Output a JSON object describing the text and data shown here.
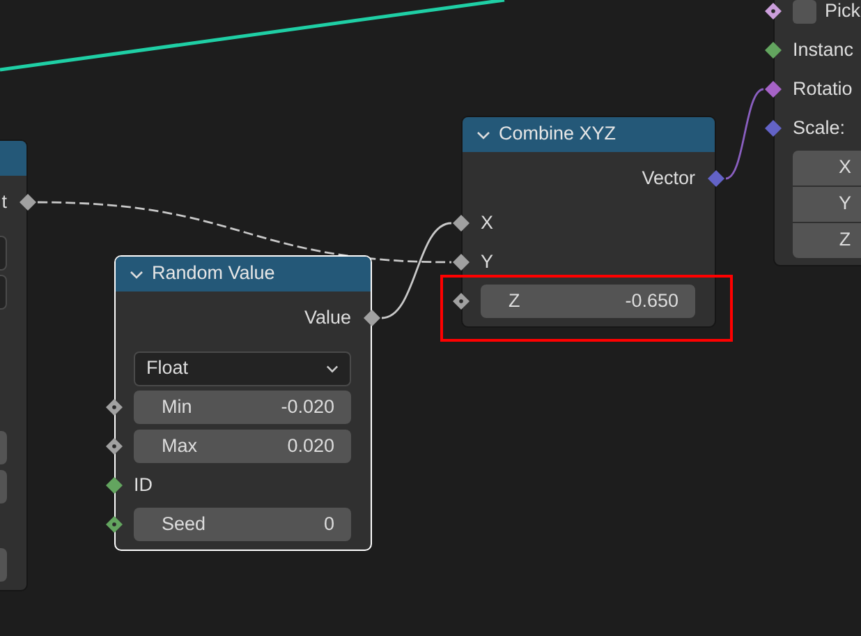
{
  "nodes": [
    {
      "kind": "partial_left",
      "selected": false,
      "rows": [
        {
          "kind": "output",
          "label": "t",
          "socket": {
            "color": "#a1a1a1",
            "dotted": false
          }
        },
        {
          "kind": "dropdown"
        },
        {
          "kind": "dropdown"
        },
        {
          "kind": "spacer"
        },
        {
          "kind": "spacer"
        },
        {
          "kind": "spacer"
        },
        {
          "kind": "field"
        },
        {
          "kind": "field"
        },
        {
          "kind": "spacer"
        },
        {
          "kind": "field"
        }
      ]
    },
    {
      "kind": "full",
      "title": "Combine XYZ",
      "expanded": true,
      "selected": false,
      "rows": [
        {
          "kind": "output",
          "label": "Vector",
          "socket": {
            "color": "#6363c7",
            "dotted": false
          }
        },
        {
          "kind": "input",
          "label": "X",
          "socket": {
            "color": "#a1a1a1",
            "dotted": false
          }
        },
        {
          "kind": "input",
          "label": "Y",
          "socket": {
            "color": "#a1a1a1",
            "dotted": false
          }
        },
        {
          "kind": "field",
          "label": "Z",
          "value": "-0.650",
          "highlighted": true,
          "socket": {
            "color": "#a1a1a1",
            "dotted": true
          }
        }
      ]
    },
    {
      "kind": "full",
      "title": "Random Value",
      "expanded": true,
      "selected": true,
      "rows": [
        {
          "kind": "output",
          "label": "Value",
          "socket": {
            "color": "#a1a1a1",
            "dotted": false
          }
        },
        {
          "kind": "dropdown",
          "value": "Float"
        },
        {
          "kind": "field",
          "label": "Min",
          "value": "-0.020",
          "socket": {
            "color": "#a1a1a1",
            "dotted": true
          }
        },
        {
          "kind": "field",
          "label": "Max",
          "value": "0.020",
          "socket": {
            "color": "#a1a1a1",
            "dotted": true
          }
        },
        {
          "kind": "input",
          "label": "ID",
          "socket": {
            "color": "#63a55f",
            "dotted": false
          }
        },
        {
          "kind": "field",
          "label": "Seed",
          "value": "0",
          "socket": {
            "color": "#63a55f",
            "dotted": true
          }
        }
      ]
    },
    {
      "kind": "partial_right",
      "selected": false,
      "rows": [
        {
          "kind": "checkbox",
          "label": "Pick",
          "checked": false,
          "socket": {
            "color": "#cc9fdc",
            "dotted": true
          }
        },
        {
          "kind": "input",
          "label": "Instanc",
          "socket": {
            "color": "#63a55f",
            "dotted": false
          }
        },
        {
          "kind": "input",
          "label": "Rotatio",
          "socket": {
            "color": "#a663c7",
            "dotted": false
          }
        },
        {
          "kind": "input",
          "label": "Scale:",
          "socket": {
            "color": "#6363c7",
            "dotted": false
          }
        },
        {
          "kind": "stack_field",
          "label": "X"
        },
        {
          "kind": "stack_field",
          "label": "Y"
        },
        {
          "kind": "stack_field",
          "label": "Z"
        }
      ]
    }
  ]
}
